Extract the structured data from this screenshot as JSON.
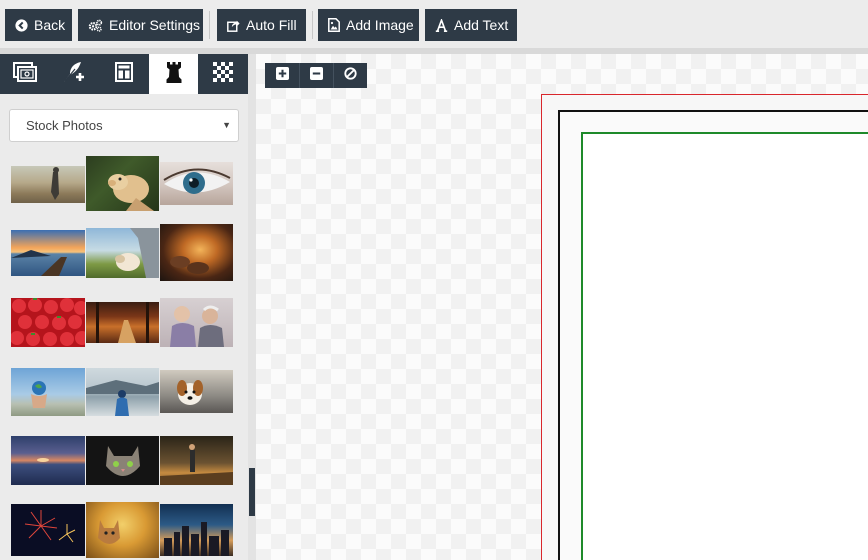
{
  "toolbar": {
    "back_label": "Back",
    "editor_settings_label": "Editor Settings",
    "auto_fill_label": "Auto Fill",
    "add_image_label": "Add Image",
    "add_text_label": "Add Text"
  },
  "icons": {
    "back": "circle-arrow-left-icon",
    "editor_settings": "gears-icon",
    "auto_fill": "share-icon",
    "add_image": "image-file-icon",
    "add_text": "font-icon"
  },
  "sidebar": {
    "tabs": [
      {
        "icon": "photos-icon",
        "active": false
      },
      {
        "icon": "feather-plus-icon",
        "active": false
      },
      {
        "icon": "layout-icon",
        "active": false
      },
      {
        "icon": "chess-rook-icon",
        "active": true
      },
      {
        "icon": "checkerboard-icon",
        "active": false
      }
    ],
    "source_select": {
      "value": "Stock Photos"
    },
    "photos": [
      "person-hiking-photo",
      "dog-in-grass-photo",
      "blue-eye-photo",
      "lake-dock-sunset-photo",
      "dog-in-car-photo",
      "feet-campfire-photo",
      "strawberries-photo",
      "autumn-forest-road-photo",
      "elderly-couple-photo",
      "hand-holding-globe-photo",
      "person-by-lake-photo",
      "puppy-photo",
      "sunset-over-water-photo",
      "cat-portrait-photo",
      "person-on-bridge-photo",
      "fireworks-photo",
      "kitten-in-meadow-photo",
      "city-skyline-night-photo"
    ]
  },
  "zoom_controls": {
    "zoom_in": "plus-square-icon",
    "zoom_out": "minus-square-icon",
    "reset": "ban-icon"
  },
  "colors": {
    "toolbar_button": "#2e3a46",
    "bleed_line": "#d9262c",
    "trim_line": "#111111",
    "safe_line": "#1e8a2a"
  }
}
